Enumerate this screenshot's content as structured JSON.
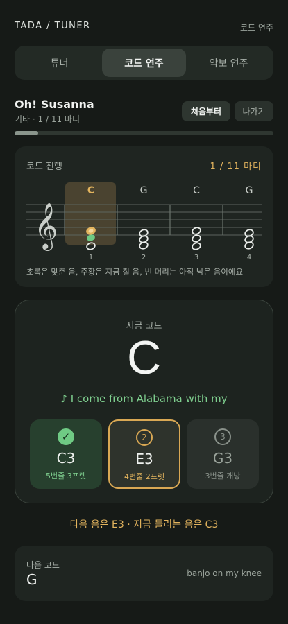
{
  "header": {
    "brand": "TADA / TUNER",
    "mode": "코드 연주"
  },
  "tabs": [
    {
      "label": "튜너",
      "active": false
    },
    {
      "label": "코드 연주",
      "active": true
    },
    {
      "label": "악보 연주",
      "active": false
    }
  ],
  "song": {
    "title": "Oh! Susanna",
    "meta": "기타 · 1 / 11 마디",
    "restart_label": "처음부터",
    "exit_label": "나가기",
    "progress": 0.09
  },
  "progression": {
    "title": "코드 진행",
    "bar_count": "1 / 11 마디",
    "chords": [
      "C",
      "G",
      "C",
      "G"
    ],
    "bar_numbers": [
      "1",
      "2",
      "3",
      "4"
    ],
    "active_index": 0,
    "legend": "초록은 맞춘 음, 주황은 지금 칠 음, 빈 머리는 아직 남은 음이에요"
  },
  "current": {
    "label": "지금 코드",
    "chord": "C",
    "lyric": "♪ I come from Alabama with my",
    "notes": [
      {
        "status": "done",
        "icon": "check-icon",
        "glyph": "✓",
        "name": "C3",
        "position": "5번줄 3프렛"
      },
      {
        "status": "current",
        "icon": "circled-2-icon",
        "glyph": "2",
        "name": "E3",
        "position": "4번줄 2프렛"
      },
      {
        "status": "pending",
        "icon": "circled-3-icon",
        "glyph": "3",
        "name": "G3",
        "position": "3번줄 개방"
      }
    ]
  },
  "status_text": "다음 음은 E3 · 지금 들리는 음은 C3",
  "next": {
    "label": "다음 코드",
    "chord": "G",
    "lyric": "banjo on my knee"
  },
  "colors": {
    "accent_orange": "#e3b45e",
    "accent_green": "#7fcf8f",
    "background": "#161a17"
  }
}
